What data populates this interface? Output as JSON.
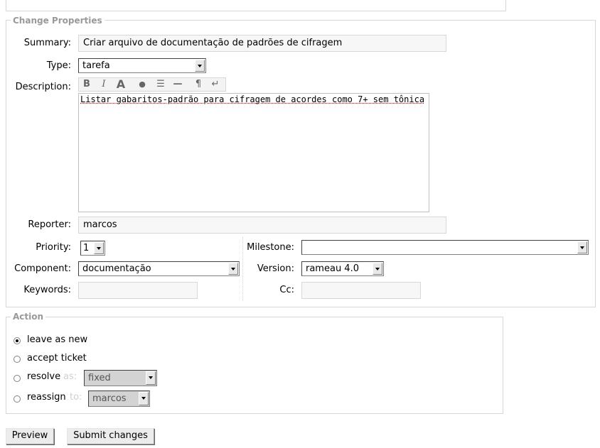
{
  "change_properties": {
    "legend": "Change Properties",
    "summary": {
      "label": "Summary:",
      "value": "Criar arquivo de documentação de padrões de cifragem"
    },
    "type": {
      "label": "Type:",
      "value": "tarefa"
    },
    "description": {
      "label": "Description:",
      "toolbar": [
        "B",
        "I",
        "A",
        "●",
        "☰",
        "—",
        "¶",
        "↵"
      ],
      "value": "Listar gabaritos-padrão para cifragem de acordes como 7+ sem tônica"
    },
    "reporter": {
      "label": "Reporter:",
      "value": "marcos"
    },
    "priority": {
      "label": "Priority:",
      "value": "1"
    },
    "milestone": {
      "label": "Milestone:",
      "value": ""
    },
    "component": {
      "label": "Component:",
      "value": "documentação"
    },
    "version": {
      "label": "Version:",
      "value": "rameau 4.0"
    },
    "keywords": {
      "label": "Keywords:",
      "value": ""
    },
    "cc": {
      "label": "Cc:",
      "value": ""
    }
  },
  "action": {
    "legend": "Action",
    "options": [
      {
        "label": "leave as new",
        "checked": true
      },
      {
        "label": "accept ticket",
        "checked": false
      },
      {
        "label": "resolve",
        "suffix": "as:",
        "select": "fixed"
      },
      {
        "label": "reassign",
        "suffix": "to:",
        "select": "marcos"
      }
    ]
  },
  "buttons": {
    "preview": "Preview",
    "submit": "Submit changes"
  }
}
